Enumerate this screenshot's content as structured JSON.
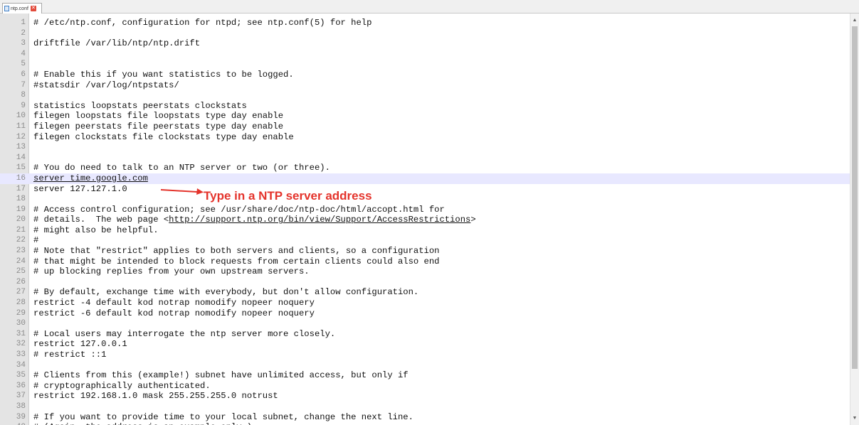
{
  "tab": {
    "label": "ntp.conf",
    "close_glyph": "✕"
  },
  "annotation": {
    "text": "Type in a NTP server address",
    "color": "#e4332b"
  },
  "editor": {
    "lines": [
      {
        "n": "1",
        "text": "# /etc/ntp.conf, configuration for ntpd; see ntp.conf(5) for help"
      },
      {
        "n": "2",
        "text": ""
      },
      {
        "n": "3",
        "text": "driftfile /var/lib/ntp/ntp.drift"
      },
      {
        "n": "4",
        "text": ""
      },
      {
        "n": "5",
        "text": ""
      },
      {
        "n": "6",
        "text": "# Enable this if you want statistics to be logged."
      },
      {
        "n": "7",
        "text": "#statsdir /var/log/ntpstats/"
      },
      {
        "n": "8",
        "text": ""
      },
      {
        "n": "9",
        "text": "statistics loopstats peerstats clockstats"
      },
      {
        "n": "10",
        "text": "filegen loopstats file loopstats type day enable"
      },
      {
        "n": "11",
        "text": "filegen peerstats file peerstats type day enable"
      },
      {
        "n": "12",
        "text": "filegen clockstats file clockstats type day enable"
      },
      {
        "n": "13",
        "text": ""
      },
      {
        "n": "14",
        "text": ""
      },
      {
        "n": "15",
        "text": "# You do need to talk to an NTP server or two (or three)."
      },
      {
        "n": "16",
        "text": "server time.google.com"
      },
      {
        "n": "17",
        "text": "server 127.127.1.0"
      },
      {
        "n": "18",
        "text": ""
      },
      {
        "n": "19",
        "text": "# Access control configuration; see /usr/share/doc/ntp-doc/html/accopt.html for"
      },
      {
        "n": "20",
        "pre": "# details.  The web page <",
        "link": "http://support.ntp.org/bin/view/Support/AccessRestrictions",
        "post": ">"
      },
      {
        "n": "21",
        "text": "# might also be helpful."
      },
      {
        "n": "22",
        "text": "#"
      },
      {
        "n": "23",
        "text": "# Note that \"restrict\" applies to both servers and clients, so a configuration"
      },
      {
        "n": "24",
        "text": "# that might be intended to block requests from certain clients could also end"
      },
      {
        "n": "25",
        "text": "# up blocking replies from your own upstream servers."
      },
      {
        "n": "26",
        "text": ""
      },
      {
        "n": "27",
        "text": "# By default, exchange time with everybody, but don't allow configuration."
      },
      {
        "n": "28",
        "text": "restrict -4 default kod notrap nomodify nopeer noquery"
      },
      {
        "n": "29",
        "text": "restrict -6 default kod notrap nomodify nopeer noquery"
      },
      {
        "n": "30",
        "text": ""
      },
      {
        "n": "31",
        "text": "# Local users may interrogate the ntp server more closely."
      },
      {
        "n": "32",
        "text": "restrict 127.0.0.1"
      },
      {
        "n": "33",
        "text": "# restrict ::1"
      },
      {
        "n": "34",
        "text": ""
      },
      {
        "n": "35",
        "text": "# Clients from this (example!) subnet have unlimited access, but only if"
      },
      {
        "n": "36",
        "text": "# cryptographically authenticated."
      },
      {
        "n": "37",
        "text": "restrict 192.168.1.0 mask 255.255.255.0 notrust"
      },
      {
        "n": "38",
        "text": ""
      },
      {
        "n": "39",
        "text": "# If you want to provide time to your local subnet, change the next line."
      },
      {
        "n": "40",
        "text": "# (Again, the address is an example only.)"
      }
    ]
  }
}
